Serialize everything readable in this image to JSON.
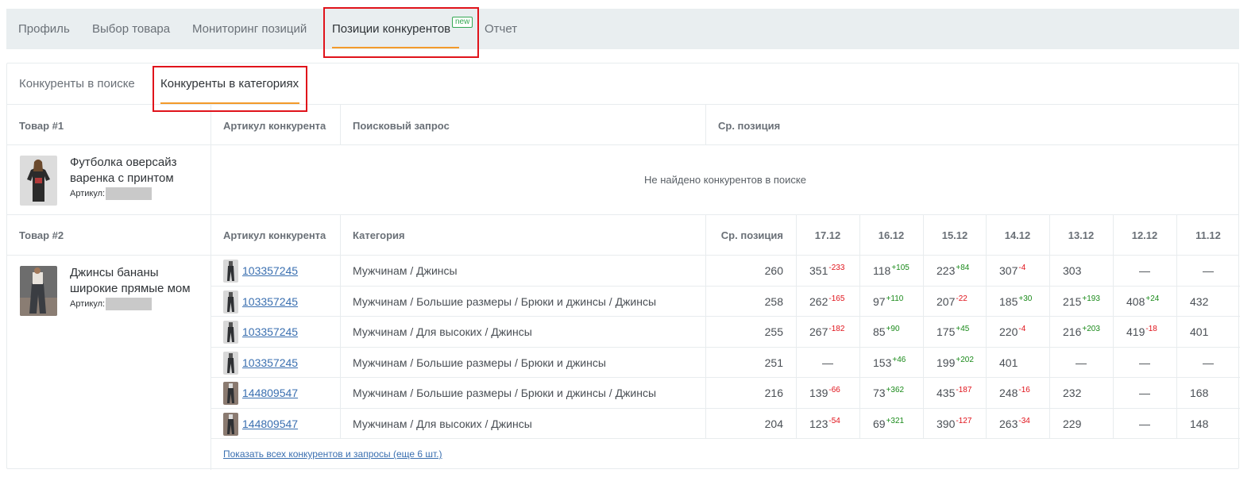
{
  "topnav": {
    "tabs": [
      {
        "label": "Профиль"
      },
      {
        "label": "Выбор товара"
      },
      {
        "label": "Мониторинг позиций"
      },
      {
        "label": "Позиции конкурентов"
      },
      {
        "label": "Отчет"
      }
    ],
    "new_badge": "new",
    "active_index": 3
  },
  "subtabs": [
    {
      "label": "Конкуренты в поиске"
    },
    {
      "label": "Конкуренты в категориях"
    }
  ],
  "table1": {
    "headers": {
      "product": "Товар #1",
      "article": "Артикул конкурента",
      "query": "Поисковый запрос",
      "avg": "Ср. позиция"
    },
    "product": {
      "name_line1": "Футболка оверсайз",
      "name_line2": "варенка с принтом",
      "article_label": "Артикул:"
    },
    "empty_message": "Не найдено конкурентов в поиске"
  },
  "table2": {
    "headers": {
      "product": "Товар #2",
      "article": "Артикул конкурента",
      "category": "Категория",
      "avg": "Ср. позиция",
      "dates": [
        "17.12",
        "16.12",
        "15.12",
        "14.12",
        "13.12",
        "12.12",
        "11.12"
      ]
    },
    "product": {
      "name_line1": "Джинсы бананы",
      "name_line2": "широкие прямые мом",
      "article_label": "Артикул:"
    },
    "rows": [
      {
        "article": "103357245",
        "category": "Мужчинам / Джинсы",
        "avg": "260",
        "days": [
          {
            "v": "351",
            "d": "-233"
          },
          {
            "v": "118",
            "d": "+105"
          },
          {
            "v": "223",
            "d": "+84"
          },
          {
            "v": "307",
            "d": "-4"
          },
          {
            "v": "303",
            "d": ""
          },
          {
            "v": "—",
            "d": ""
          },
          {
            "v": "—",
            "d": ""
          }
        ]
      },
      {
        "article": "103357245",
        "category": "Мужчинам / Большие размеры / Брюки и джинсы / Джинсы",
        "avg": "258",
        "days": [
          {
            "v": "262",
            "d": "-165"
          },
          {
            "v": "97",
            "d": "+110"
          },
          {
            "v": "207",
            "d": "-22"
          },
          {
            "v": "185",
            "d": "+30"
          },
          {
            "v": "215",
            "d": "+193"
          },
          {
            "v": "408",
            "d": "+24"
          },
          {
            "v": "432",
            "d": ""
          }
        ]
      },
      {
        "article": "103357245",
        "category": "Мужчинам / Для высоких / Джинсы",
        "avg": "255",
        "days": [
          {
            "v": "267",
            "d": "-182"
          },
          {
            "v": "85",
            "d": "+90"
          },
          {
            "v": "175",
            "d": "+45"
          },
          {
            "v": "220",
            "d": "-4"
          },
          {
            "v": "216",
            "d": "+203"
          },
          {
            "v": "419",
            "d": "-18"
          },
          {
            "v": "401",
            "d": ""
          }
        ]
      },
      {
        "article": "103357245",
        "category": "Мужчинам / Большие размеры / Брюки и джинсы",
        "avg": "251",
        "days": [
          {
            "v": "—",
            "d": ""
          },
          {
            "v": "153",
            "d": "+46"
          },
          {
            "v": "199",
            "d": "+202"
          },
          {
            "v": "401",
            "d": ""
          },
          {
            "v": "—",
            "d": ""
          },
          {
            "v": "—",
            "d": ""
          },
          {
            "v": "—",
            "d": ""
          }
        ]
      },
      {
        "article": "144809547",
        "category": "Мужчинам / Большие размеры / Брюки и джинсы / Джинсы",
        "avg": "216",
        "days": [
          {
            "v": "139",
            "d": "-66"
          },
          {
            "v": "73",
            "d": "+362"
          },
          {
            "v": "435",
            "d": "-187"
          },
          {
            "v": "248",
            "d": "-16"
          },
          {
            "v": "232",
            "d": ""
          },
          {
            "v": "—",
            "d": ""
          },
          {
            "v": "168",
            "d": ""
          }
        ]
      },
      {
        "article": "144809547",
        "category": "Мужчинам / Для высоких / Джинсы",
        "avg": "204",
        "days": [
          {
            "v": "123",
            "d": "-54"
          },
          {
            "v": "69",
            "d": "+321"
          },
          {
            "v": "390",
            "d": "-127"
          },
          {
            "v": "263",
            "d": "-34"
          },
          {
            "v": "229",
            "d": ""
          },
          {
            "v": "—",
            "d": ""
          },
          {
            "v": "148",
            "d": ""
          }
        ]
      }
    ],
    "footer_link": "Показать всех конкурентов и запросы (еще 6 шт.)"
  },
  "colors": {
    "accent": "#f39a2b",
    "highlight_box": "#e0131b",
    "positive": "#1a8a1a",
    "negative": "#e0131b",
    "link": "#3a6fb0",
    "nav_bg": "#e9eef0"
  }
}
